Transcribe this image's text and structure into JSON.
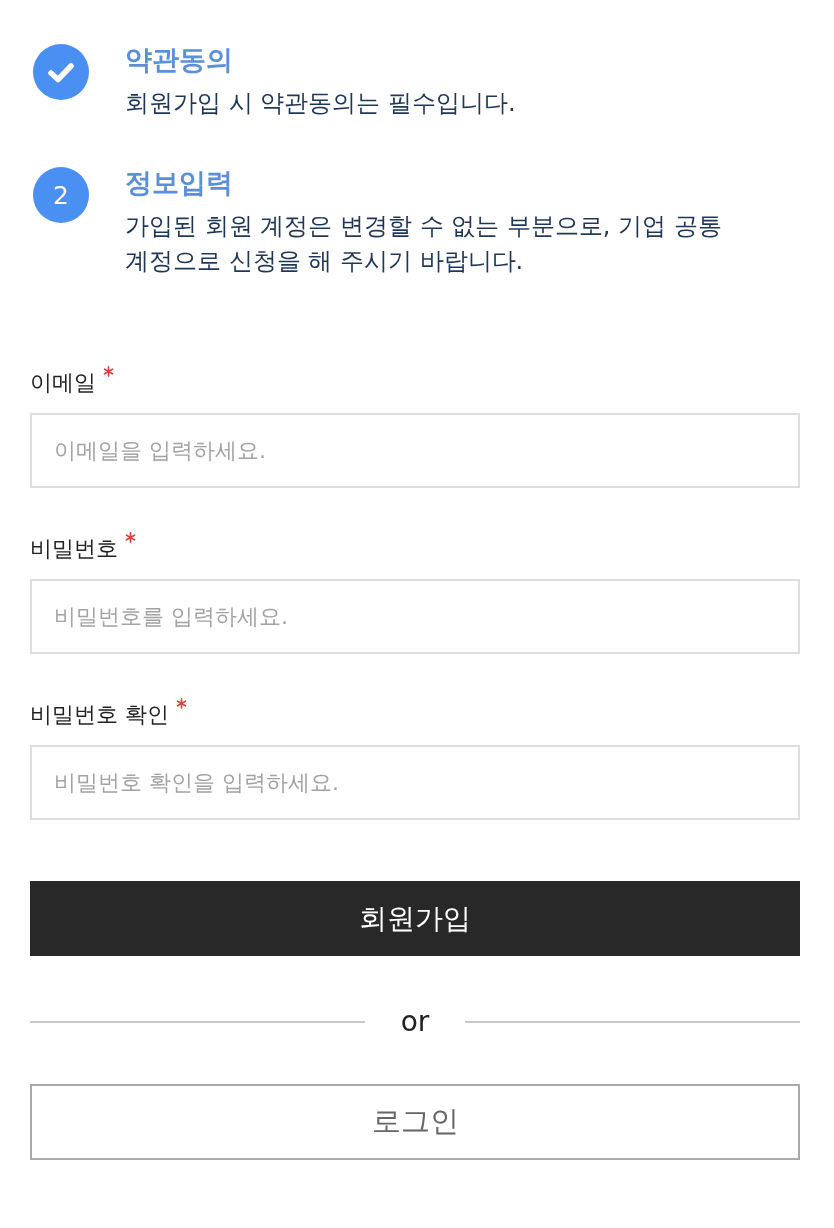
{
  "steps": [
    {
      "completed": true,
      "title": "약관동의",
      "description": "회원가입 시 약관동의는 필수입니다."
    },
    {
      "completed": false,
      "number": "2",
      "title": "정보입력",
      "description": "가입된 회원 계정은 변경할 수 없는 부분으로, 기업 공통 계정으로 신청을 해 주시기 바랍니다."
    }
  ],
  "fields": [
    {
      "label": "이메일",
      "required": true,
      "placeholder": "이메일을 입력하세요."
    },
    {
      "label": "비밀번호",
      "required": true,
      "placeholder": "비밀번호를 입력하세요."
    },
    {
      "label": "비밀번호 확인",
      "required": true,
      "placeholder": "비밀번호 확인을 입력하세요."
    }
  ],
  "signup_button": "회원가입",
  "divider": "or",
  "login_button": "로그인"
}
